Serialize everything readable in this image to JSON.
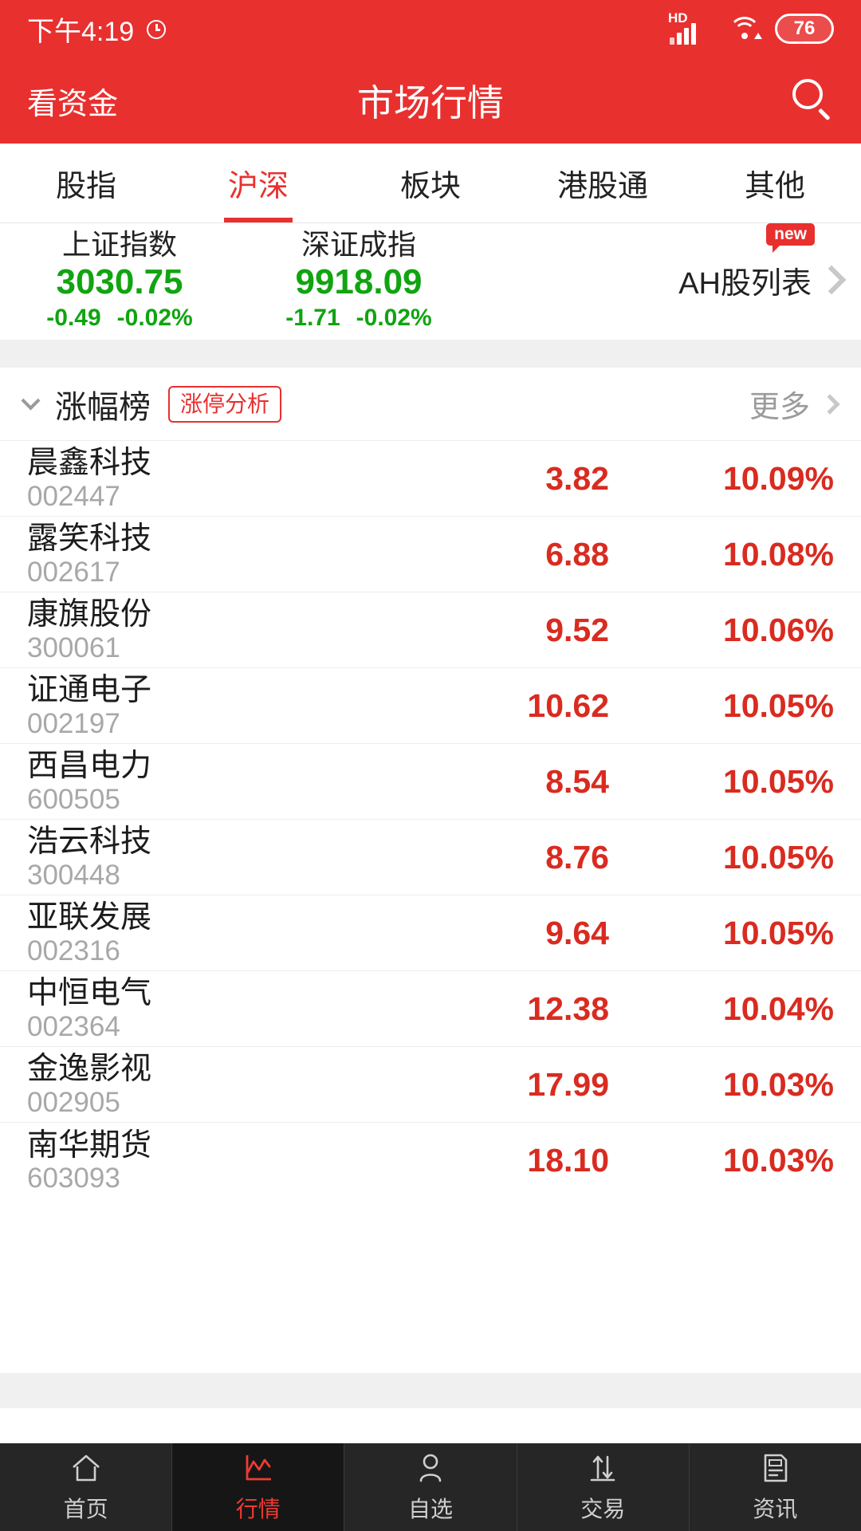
{
  "statusbar": {
    "time": "下午4:19",
    "alarm_icon": "alarm-icon",
    "hd_label": "HD",
    "signal_icon": "signal-bars-icon",
    "wifi_icon": "wifi-icon",
    "battery_level": "76"
  },
  "appbar": {
    "left_action": "看资金",
    "title": "市场行情",
    "search_icon": "search-icon"
  },
  "tabs": [
    {
      "label": "股指",
      "active": false
    },
    {
      "label": "沪深",
      "active": true
    },
    {
      "label": "板块",
      "active": false
    },
    {
      "label": "港股通",
      "active": false
    },
    {
      "label": "其他",
      "active": false
    }
  ],
  "indices": [
    {
      "name": "上证指数",
      "value": "3030.75",
      "change": "-0.49",
      "change_pct": "-0.02%",
      "direction": "down"
    },
    {
      "name": "深证成指",
      "value": "9918.09",
      "change": "-1.71",
      "change_pct": "-0.02%",
      "direction": "down"
    }
  ],
  "ah_link": {
    "label": "AH股列表",
    "badge": "new",
    "chevron_icon": "chevron-right-icon"
  },
  "section": {
    "collapse_icon": "chevron-down-icon",
    "title": "涨幅榜",
    "tag_label": "涨停分析",
    "more_label": "更多",
    "more_icon": "chevron-right-icon"
  },
  "stocks": [
    {
      "name": "晨鑫科技",
      "code": "002447",
      "price": "3.82",
      "change_pct": "10.09%"
    },
    {
      "name": "露笑科技",
      "code": "002617",
      "price": "6.88",
      "change_pct": "10.08%"
    },
    {
      "name": "康旗股份",
      "code": "300061",
      "price": "9.52",
      "change_pct": "10.06%"
    },
    {
      "name": "证通电子",
      "code": "002197",
      "price": "10.62",
      "change_pct": "10.05%"
    },
    {
      "name": "西昌电力",
      "code": "600505",
      "price": "8.54",
      "change_pct": "10.05%"
    },
    {
      "name": "浩云科技",
      "code": "300448",
      "price": "8.76",
      "change_pct": "10.05%"
    },
    {
      "name": "亚联发展",
      "code": "002316",
      "price": "9.64",
      "change_pct": "10.05%"
    },
    {
      "name": "中恒电气",
      "code": "002364",
      "price": "12.38",
      "change_pct": "10.04%"
    },
    {
      "name": "金逸影视",
      "code": "002905",
      "price": "17.99",
      "change_pct": "10.03%"
    },
    {
      "name": "南华期货",
      "code": "603093",
      "price": "18.10",
      "change_pct": "10.03%"
    }
  ],
  "bottomnav": [
    {
      "label": "首页",
      "icon": "home-icon",
      "active": false
    },
    {
      "label": "行情",
      "icon": "chart-icon",
      "active": true
    },
    {
      "label": "自选",
      "icon": "person-icon",
      "active": false
    },
    {
      "label": "交易",
      "icon": "transfer-arrows-icon",
      "active": false
    },
    {
      "label": "资讯",
      "icon": "news-icon",
      "active": false
    }
  ],
  "colors": {
    "brand_red": "#e8302f",
    "up_red": "#d92b20",
    "down_green": "#11a411",
    "muted_gray": "#a8a8a8",
    "nav_bg": "#262626"
  }
}
